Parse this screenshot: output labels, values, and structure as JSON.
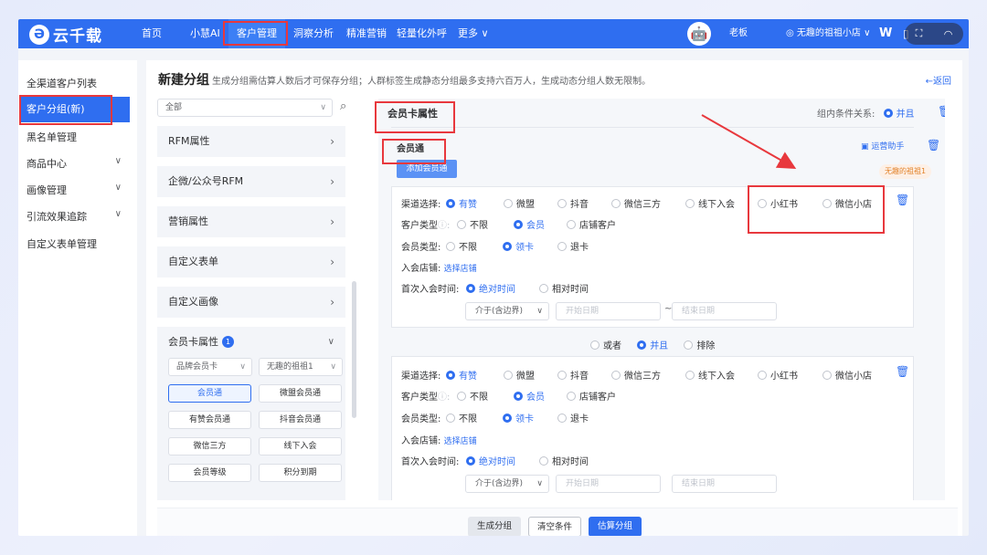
{
  "topbar": {
    "logo_mark": "Ə",
    "logo_text": "云千载",
    "nav": [
      "首页",
      "小慧AI",
      "客户管理",
      "洞察分析",
      "精准营销",
      "轻量化外呼",
      "更多 ∨"
    ],
    "user_role": "老板",
    "store": "无趣的祖祖小店 ∨",
    "avatar_icon": "🤖"
  },
  "sidebar": {
    "items": [
      {
        "label": "全渠道客户列表",
        "chevron": ""
      },
      {
        "label": "客户分组(新)",
        "chevron": ""
      },
      {
        "label": "黑名单管理",
        "chevron": ""
      },
      {
        "label": "商品中心",
        "chevron": "∨"
      },
      {
        "label": "画像管理",
        "chevron": "∨"
      },
      {
        "label": "引流效果追踪",
        "chevron": "∨"
      },
      {
        "label": "自定义表单管理",
        "chevron": ""
      }
    ]
  },
  "page": {
    "title": "新建分组",
    "description": "生成分组需估算人数后才可保存分组；人群标签生成静态分组最多支持六百万人，生成动态分组人数无限制。",
    "back_label": "←返回"
  },
  "left_panel": {
    "filter_select": "全部",
    "categories": [
      "RFM属性",
      "企微/公众号RFM",
      "营销属性",
      "自定义表单",
      "自定义画像",
      "会员卡属性"
    ],
    "member_badge": "1",
    "sub_select_1": "品牌会员卡",
    "sub_select_2": "无趣的祖祖1",
    "tags": [
      "会员通",
      "微盟会员通",
      "有赞会员通",
      "抖音会员通",
      "微信三方",
      "线下入会",
      "会员等级",
      "积分到期"
    ]
  },
  "right_panel": {
    "section_title": "会员卡属性",
    "relation_label": "组内条件关系:",
    "relation_value": "并且",
    "sub_title": "会员通",
    "ops_helper": "运营助手",
    "add_button": "添加会员通",
    "store_tag": "无趣的祖祖1",
    "channel_label": "渠道选择:",
    "channels": [
      "有赞",
      "微盟",
      "抖音",
      "微信三方",
      "线下入会",
      "小红书",
      "微信小店"
    ],
    "customer_type_label": "客户类型",
    "customer_types": [
      "不限",
      "会员",
      "店铺客户"
    ],
    "member_type_label": "会员类型:",
    "member_types": [
      "不限",
      "领卡",
      "退卡"
    ],
    "store_label": "入会店铺:",
    "store_link": "选择店铺",
    "join_time_label": "首次入会时间:",
    "time_types": [
      "绝对时间",
      "相对时间"
    ],
    "range_select": "介于(含边界)",
    "start_placeholder": "开始日期",
    "end_placeholder": "结束日期",
    "range_sep": "~",
    "logic_options": [
      "或者",
      "并且",
      "排除"
    ]
  },
  "footer": {
    "generate": "生成分组",
    "clear": "清空条件",
    "estimate": "估算分组"
  },
  "colors": {
    "primary": "#2f6ef0",
    "highlight": "#e8383d"
  }
}
